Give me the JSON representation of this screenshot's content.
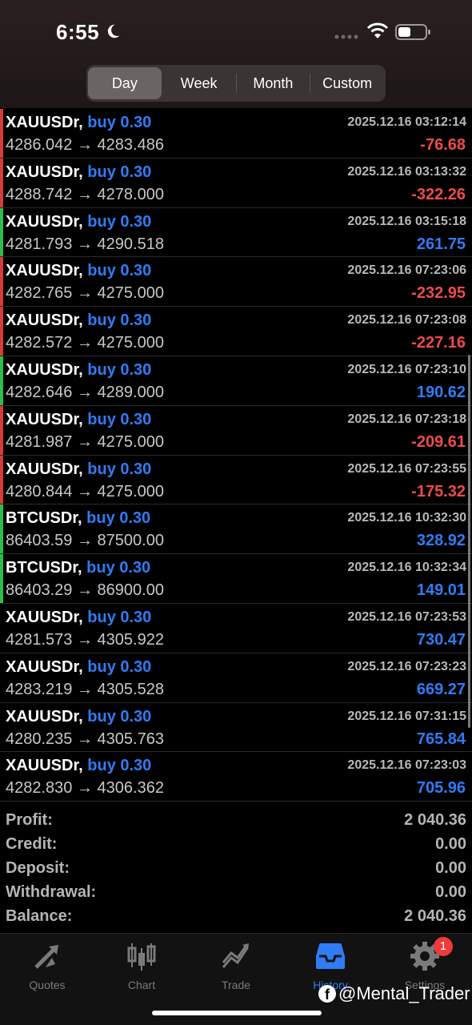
{
  "status_bar": {
    "time": "6:55"
  },
  "periods": [
    {
      "label": "Day",
      "active": true
    },
    {
      "label": "Week",
      "active": false
    },
    {
      "label": "Month",
      "active": false
    },
    {
      "label": "Custom",
      "active": false
    }
  ],
  "deals": [
    {
      "symbol": "XAUUSDr,",
      "action": "buy 0.30",
      "datetime": "2025.12.16 03:12:14",
      "prices": "4286.042 → 4283.486",
      "profit": "-76.68",
      "result": "loss"
    },
    {
      "symbol": "XAUUSDr,",
      "action": "buy 0.30",
      "datetime": "2025.12.16 03:13:32",
      "prices": "4288.742 → 4278.000",
      "profit": "-322.26",
      "result": "loss"
    },
    {
      "symbol": "XAUUSDr,",
      "action": "buy 0.30",
      "datetime": "2025.12.16 03:15:18",
      "prices": "4281.793 → 4290.518",
      "profit": "261.75",
      "result": "profit"
    },
    {
      "symbol": "XAUUSDr,",
      "action": "buy 0.30",
      "datetime": "2025.12.16 07:23:06",
      "prices": "4282.765 → 4275.000",
      "profit": "-232.95",
      "result": "loss"
    },
    {
      "symbol": "XAUUSDr,",
      "action": "buy 0.30",
      "datetime": "2025.12.16 07:23:08",
      "prices": "4282.572 → 4275.000",
      "profit": "-227.16",
      "result": "loss"
    },
    {
      "symbol": "XAUUSDr,",
      "action": "buy 0.30",
      "datetime": "2025.12.16 07:23:10",
      "prices": "4282.646 → 4289.000",
      "profit": "190.62",
      "result": "profit"
    },
    {
      "symbol": "XAUUSDr,",
      "action": "buy 0.30",
      "datetime": "2025.12.16 07:23:18",
      "prices": "4281.987 → 4275.000",
      "profit": "-209.61",
      "result": "loss"
    },
    {
      "symbol": "XAUUSDr,",
      "action": "buy 0.30",
      "datetime": "2025.12.16 07:23:55",
      "prices": "4280.844 → 4275.000",
      "profit": "-175.32",
      "result": "loss"
    },
    {
      "symbol": "BTCUSDr,",
      "action": "buy 0.30",
      "datetime": "2025.12.16 10:32:30",
      "prices": "86403.59 → 87500.00",
      "profit": "328.92",
      "result": "profit"
    },
    {
      "symbol": "BTCUSDr,",
      "action": "buy 0.30",
      "datetime": "2025.12.16 10:32:34",
      "prices": "86403.29 → 86900.00",
      "profit": "149.01",
      "result": "profit"
    },
    {
      "symbol": "XAUUSDr,",
      "action": "buy 0.30",
      "datetime": "2025.12.16 07:23:53",
      "prices": "4281.573 → 4305.922",
      "profit": "730.47",
      "result": "none"
    },
    {
      "symbol": "XAUUSDr,",
      "action": "buy 0.30",
      "datetime": "2025.12.16 07:23:23",
      "prices": "4283.219 → 4305.528",
      "profit": "669.27",
      "result": "none"
    },
    {
      "symbol": "XAUUSDr,",
      "action": "buy 0.30",
      "datetime": "2025.12.16 07:31:15",
      "prices": "4280.235 → 4305.763",
      "profit": "765.84",
      "result": "none"
    },
    {
      "symbol": "XAUUSDr,",
      "action": "buy 0.30",
      "datetime": "2025.12.16 07:23:03",
      "prices": "4282.830 → 4306.362",
      "profit": "705.96",
      "result": "none"
    }
  ],
  "summary": [
    {
      "label": "Profit:",
      "value": "2 040.36"
    },
    {
      "label": "Credit:",
      "value": "0.00"
    },
    {
      "label": "Deposit:",
      "value": "0.00"
    },
    {
      "label": "Withdrawal:",
      "value": "0.00"
    },
    {
      "label": "Balance:",
      "value": "2 040.36"
    }
  ],
  "tabs": [
    {
      "label": "Quotes",
      "icon": "quotes-icon",
      "active": false
    },
    {
      "label": "Chart",
      "icon": "chart-icon",
      "active": false
    },
    {
      "label": "Trade",
      "icon": "trade-icon",
      "active": false
    },
    {
      "label": "History",
      "icon": "history-icon",
      "active": true
    },
    {
      "label": "Settings",
      "icon": "settings-icon",
      "active": false,
      "badge": "1"
    }
  ],
  "watermark": {
    "text": "@Mental_Trader"
  },
  "colors": {
    "accent_blue": "#2f7cf6",
    "loss_red": "#ee4b4b",
    "profit_green": "#2dbd4c",
    "loss_bar_red": "#d83b3b"
  }
}
